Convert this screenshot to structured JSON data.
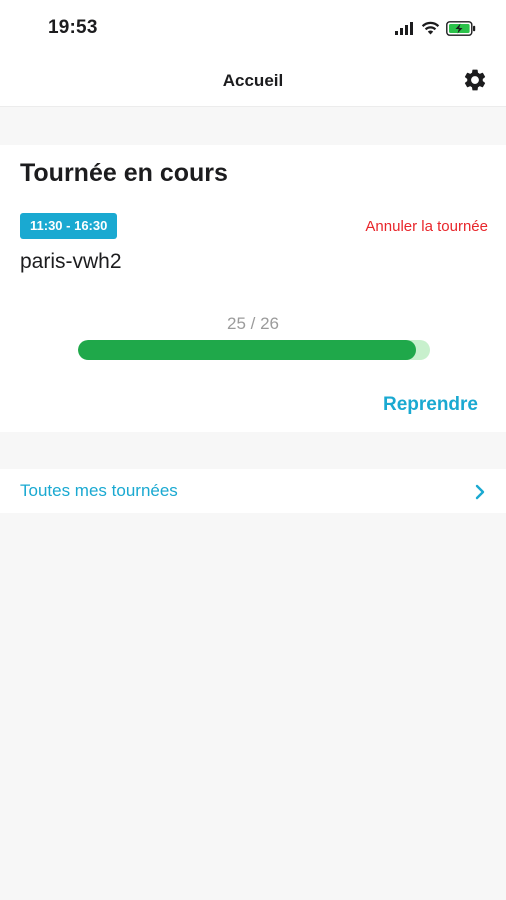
{
  "status_bar": {
    "time": "19:53",
    "icons": [
      "signal-icon",
      "wifi-icon",
      "battery-charging-icon"
    ]
  },
  "nav": {
    "title": "Accueil",
    "settings_icon": "gear-icon"
  },
  "current_route": {
    "heading": "Tournée en cours",
    "time_window": "11:30 - 16:30",
    "cancel_label": "Annuler la tournée",
    "route_name": "paris-vwh2",
    "progress_text": "25 / 26",
    "progress_done": 25,
    "progress_total": 26,
    "resume_label": "Reprendre"
  },
  "all_routes": {
    "label": "Toutes mes tournées",
    "icon": "chevron-right-icon"
  },
  "colors": {
    "accent": "#1aa9d1",
    "danger": "#e8262b",
    "progress": "#1fa84a",
    "progress_track": "#c8f0cd",
    "battery": "#2bc24a"
  }
}
